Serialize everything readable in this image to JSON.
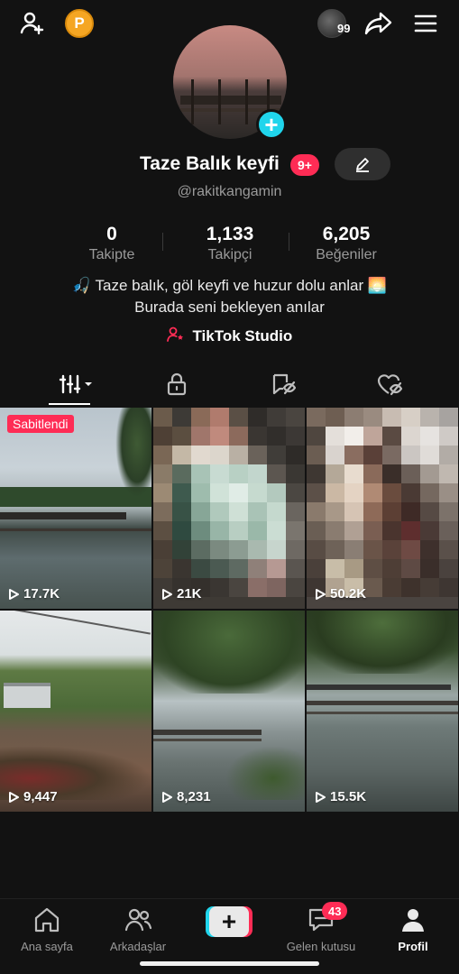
{
  "top_bar": {
    "coin_label": "P",
    "profile_badge": "99"
  },
  "profile": {
    "name": "Taze Balık keyfi",
    "notification_badge": "9+",
    "handle": "@rakitkangamin",
    "stats": [
      {
        "value": "0",
        "label": "Takipte"
      },
      {
        "value": "1,133",
        "label": "Takipçi"
      },
      {
        "value": "6,205",
        "label": "Beğeniler"
      }
    ],
    "bio_line1": "🎣 Taze balık, göl keyfi ve huzur dolu anlar 🌅",
    "bio_line2": "Burada seni bekleyen anılar",
    "studio_link": "TikTok Studio"
  },
  "tabs": [
    "videos-tab",
    "private-tab",
    "reposts-tab",
    "liked-tab"
  ],
  "videos": [
    {
      "views": "17.7K",
      "pinned": "Sabitlendi"
    },
    {
      "views": "21K"
    },
    {
      "views": "50.2K"
    },
    {
      "views": "9,447"
    },
    {
      "views": "8,231"
    },
    {
      "views": "15.5K"
    }
  ],
  "bottom_nav": {
    "home": "Ana sayfa",
    "friends": "Arkadaşlar",
    "create": "+",
    "inbox": "Gelen kutusu",
    "inbox_badge": "43",
    "profile": "Profil"
  },
  "colors": {
    "accent": "#fe2c55",
    "cyan": "#20d5ec",
    "background": "#121212"
  }
}
